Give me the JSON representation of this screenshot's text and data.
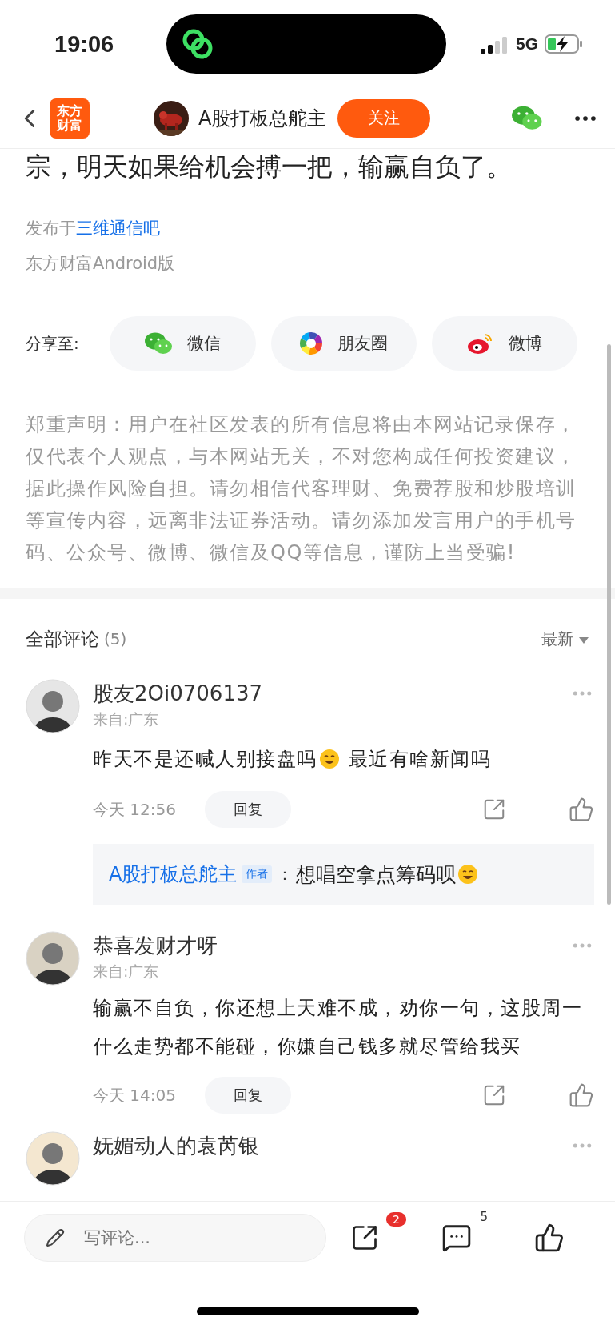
{
  "status_bar": {
    "time": "19:06",
    "network": "5G"
  },
  "nav": {
    "logo_lines": [
      "东方",
      "财富"
    ],
    "title": "A股打板总舵主",
    "follow_button": "关注"
  },
  "post": {
    "text": "宗，明天如果给机会搏一把，输赢自负了。",
    "published_prefix": "发布于",
    "forum": "三维通信吧",
    "source": "东方财富Android版"
  },
  "share": {
    "label": "分享至:",
    "targets": [
      {
        "kind": "wechat",
        "label": "微信"
      },
      {
        "kind": "moments",
        "label": "朋友圈"
      },
      {
        "kind": "weibo",
        "label": "微博"
      }
    ]
  },
  "disclaimer": "郑重声明：用户在社区发表的所有信息将由本网站记录保存，仅代表个人观点，与本网站无关，不对您构成任何投资建议，据此操作风险自担。请勿相信代客理财、免费荐股和炒股培训等宣传内容，远离非法证券活动。请勿添加发言用户的手机号码、公众号、微博、微信及QQ等信息，谨防上当受骗!",
  "comments_header": {
    "title": "全部评论",
    "count": "(5)",
    "sort": "最新"
  },
  "comments": [
    {
      "user": "股友2Oi0706137",
      "location": "来自:广东",
      "content": [
        {
          "kind": "text",
          "text": "昨天不是还喊人别接盘吗"
        },
        {
          "kind": "emoji"
        },
        {
          "kind": "text",
          "text": " 最近有啥新闻吗"
        }
      ],
      "time": "今天 12:56",
      "reply_button": "回复",
      "replies": [
        {
          "user": "A股打板总舵主",
          "badge": "作者",
          "separator": "：",
          "content": [
            {
              "kind": "text",
              "text": "想唱空拿点筹码呗"
            },
            {
              "kind": "emoji"
            }
          ]
        }
      ]
    },
    {
      "user": "恭喜发财才呀",
      "location": "来自:广东",
      "content": [
        {
          "kind": "text",
          "text": "输赢不自负，你还想上天难不成，劝你一句，这股周一什么走势都不能碰，你嫌自己钱多就尽管给我买"
        }
      ],
      "time": "今天 14:05",
      "reply_button": "回复"
    },
    {
      "user": "妩媚动人的袁芮银"
    }
  ],
  "bottom_bar": {
    "placeholder": "写评论...",
    "share_badge": "2",
    "comment_count": "5"
  }
}
